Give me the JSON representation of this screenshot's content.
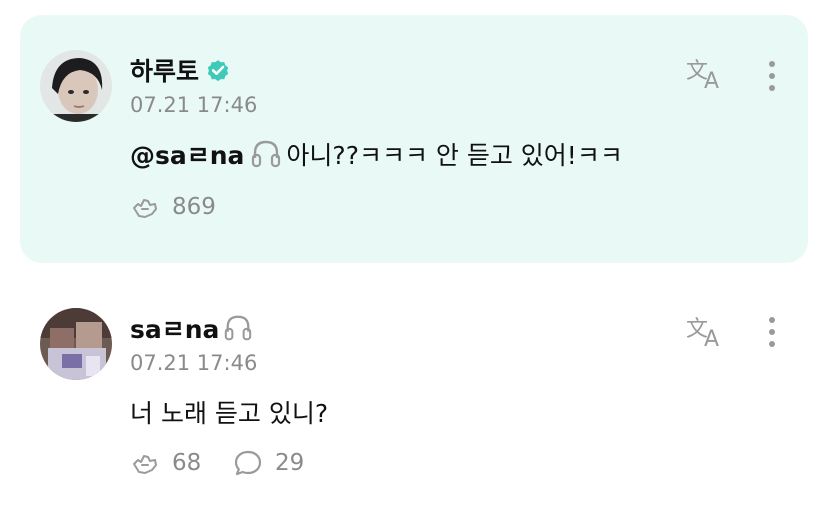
{
  "colors": {
    "highlight_bg": "#e9faf6",
    "verified": "#3fc9b8",
    "muted": "#8a8a8a",
    "text": "#111111"
  },
  "comments": [
    {
      "author": "하루토",
      "verified": true,
      "time": "07.21 17:46",
      "mention": "@saㄹna",
      "text": "아니??ㅋㅋㅋ 안 듣고 있어!ㅋㅋ",
      "likes": "869",
      "icons": [
        "verified-badge-icon",
        "headphones-icon",
        "translate-icon",
        "more-icon",
        "like-icon"
      ]
    },
    {
      "author": "saㄹna",
      "verified": false,
      "time": "07.21 17:46",
      "text": "너 노래 듣고 있니?",
      "likes": "68",
      "replies": "29",
      "icons": [
        "headphones-icon",
        "translate-icon",
        "more-icon",
        "like-icon",
        "reply-icon"
      ]
    }
  ]
}
